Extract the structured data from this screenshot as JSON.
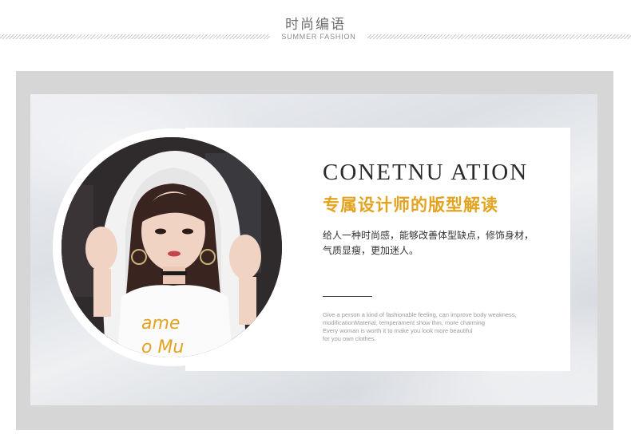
{
  "header": {
    "title": "时尚编语",
    "subtitle": "SUMMER FASHION"
  },
  "feature": {
    "title": "CONETNU ATION",
    "subtitle": "专属设计师的版型解读",
    "description": "给人一种时尚感，能够改善体型缺点，修饰身材，气质显瘦，更加迷人。",
    "english_lines": [
      "Give a person a kind of fashionable feeling, can improve body weakness,",
      " modificationMaterial, temperament show thin, more charming",
      "Every woman is worth it to make you look more beautiful",
      "for you own clothes."
    ],
    "photo_shirt_lines": [
      "ame",
      "o Mu"
    ]
  },
  "colors": {
    "accent": "#e3a31f",
    "frame": "#d6d6d6"
  }
}
